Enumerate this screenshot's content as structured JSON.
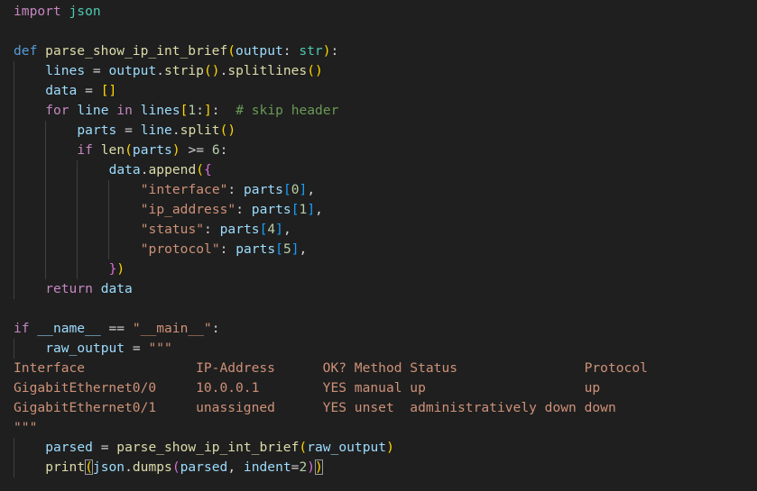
{
  "editor": {
    "language": "python",
    "theme_colors": {
      "background": "#1f1f1f",
      "keyword_control": "#c586c0",
      "keyword": "#569cd6",
      "function": "#dcdcaa",
      "variable": "#9cdcfe",
      "string": "#ce9178",
      "number": "#b5cea8",
      "comment": "#6a9955",
      "type": "#4ec9b0",
      "bracket_1": "#ffd700",
      "bracket_2": "#da70d6",
      "bracket_3": "#179fff"
    },
    "code_lines": [
      "import json",
      "",
      "def parse_show_ip_int_brief(output: str):",
      "    lines = output.strip().splitlines()",
      "    data = []",
      "    for line in lines[1:]:  # skip header",
      "        parts = line.split()",
      "        if len(parts) >= 6:",
      "            data.append({",
      "                \"interface\": parts[0],",
      "                \"ip_address\": parts[1],",
      "                \"status\": parts[4],",
      "                \"protocol\": parts[5],",
      "            })",
      "    return data",
      "",
      "if __name__ == \"__main__\":",
      "    raw_output = \"\"\"",
      "Interface              IP-Address      OK? Method Status                Protocol",
      "GigabitEthernet0/0     10.0.0.1        YES manual up                    up",
      "GigabitEthernet0/1     unassigned      YES unset  administratively down down",
      "\"\"\"",
      "    parsed = parse_show_ip_int_brief(raw_output)",
      "    print(json.dumps(parsed, indent=2))"
    ]
  }
}
